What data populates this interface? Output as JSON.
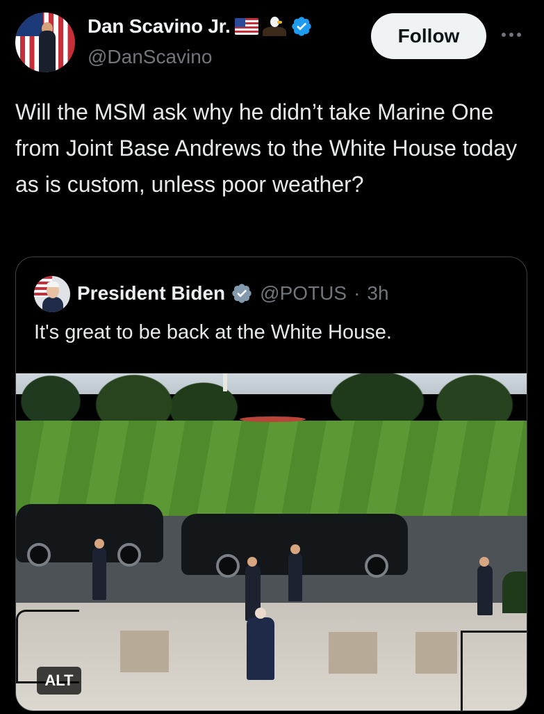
{
  "author": {
    "display_name": "Dan Scavino Jr.",
    "handle": "@DanScavino",
    "emojis": [
      "us-flag-emoji",
      "eagle-emoji"
    ],
    "verified_color": "#1d9bf0"
  },
  "follow_button": {
    "label": "Follow"
  },
  "more_menu": {
    "icon": "more-horizontal-icon"
  },
  "tweet": {
    "text": "Will the MSM ask why he didn’t take Marine One from Joint Base Andrews to the White House today as is custom, unless poor weather?"
  },
  "quoted_tweet": {
    "display_name": "President Biden",
    "handle": "@POTUS",
    "separator": "·",
    "time": "3h",
    "text": "It's great to be back at the White House.",
    "verified_color": "#829aab",
    "media": {
      "alt_label": "ALT"
    }
  },
  "colors": {
    "background": "#000000",
    "text_primary": "#e7e9ea",
    "text_secondary": "#71767b",
    "follow_bg": "#eff3f4",
    "quote_border": "#3e4144"
  }
}
